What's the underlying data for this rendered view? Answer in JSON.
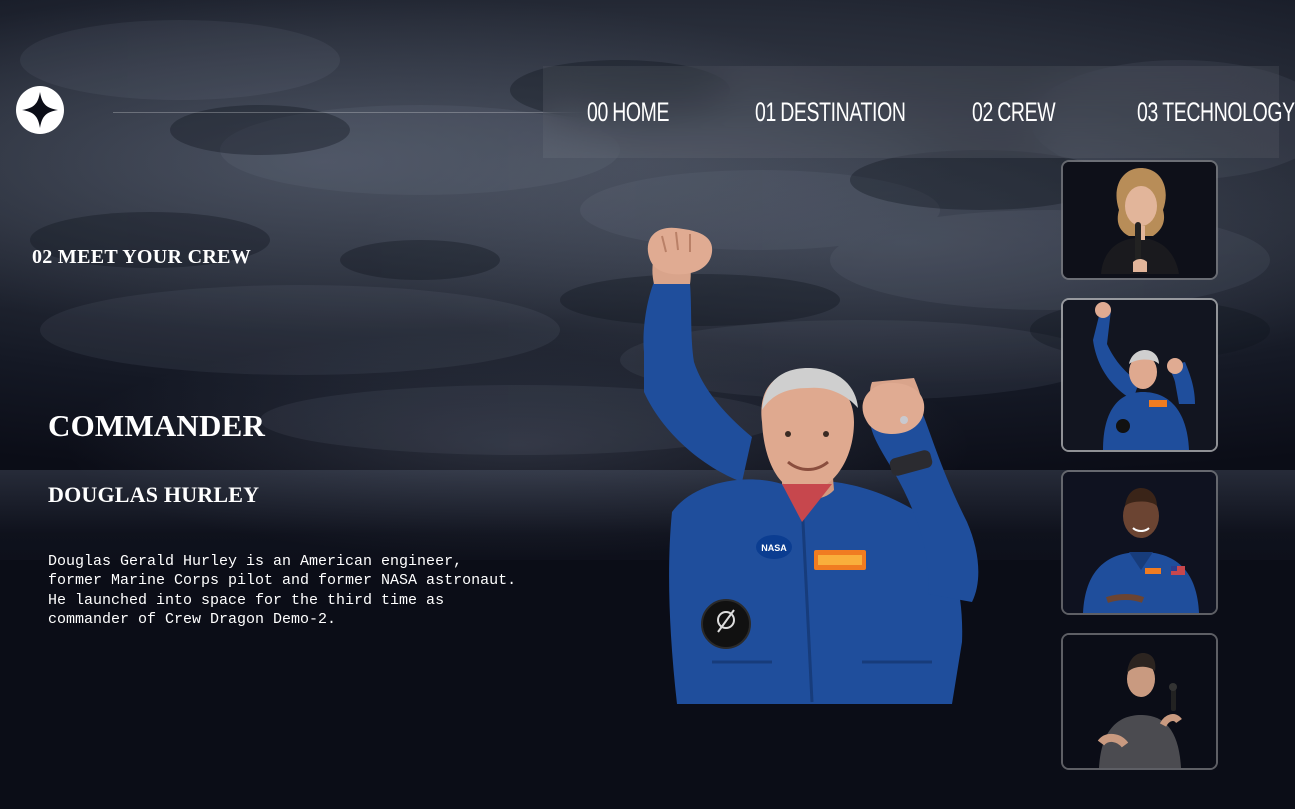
{
  "nav": {
    "items": [
      {
        "num": "00",
        "label": "HOME"
      },
      {
        "num": "01",
        "label": "DESTINATION"
      },
      {
        "num": "02",
        "label": "CREW"
      },
      {
        "num": "03",
        "label": "TECHNOLOGY"
      }
    ]
  },
  "page": {
    "eyebrow": "02 MEET YOUR CREW"
  },
  "crew_member": {
    "role": "COMMANDER",
    "name": "DOUGLAS HURLEY",
    "bio": "Douglas Gerald Hurley is an American engineer, former Marine Corps pilot and former NASA astronaut. He launched into space for the third time as commander of Crew Dragon Demo-2."
  },
  "thumbnails": [
    {
      "icon": "crew-photo-speaker-woman"
    },
    {
      "icon": "crew-photo-douglas-hurley"
    },
    {
      "icon": "crew-photo-astronaut-blue-suit"
    },
    {
      "icon": "crew-photo-speaker-man"
    }
  ],
  "colors": {
    "background": "#0b0d17",
    "text": "#ffffff",
    "suit_blue": "#1f4e9c"
  }
}
